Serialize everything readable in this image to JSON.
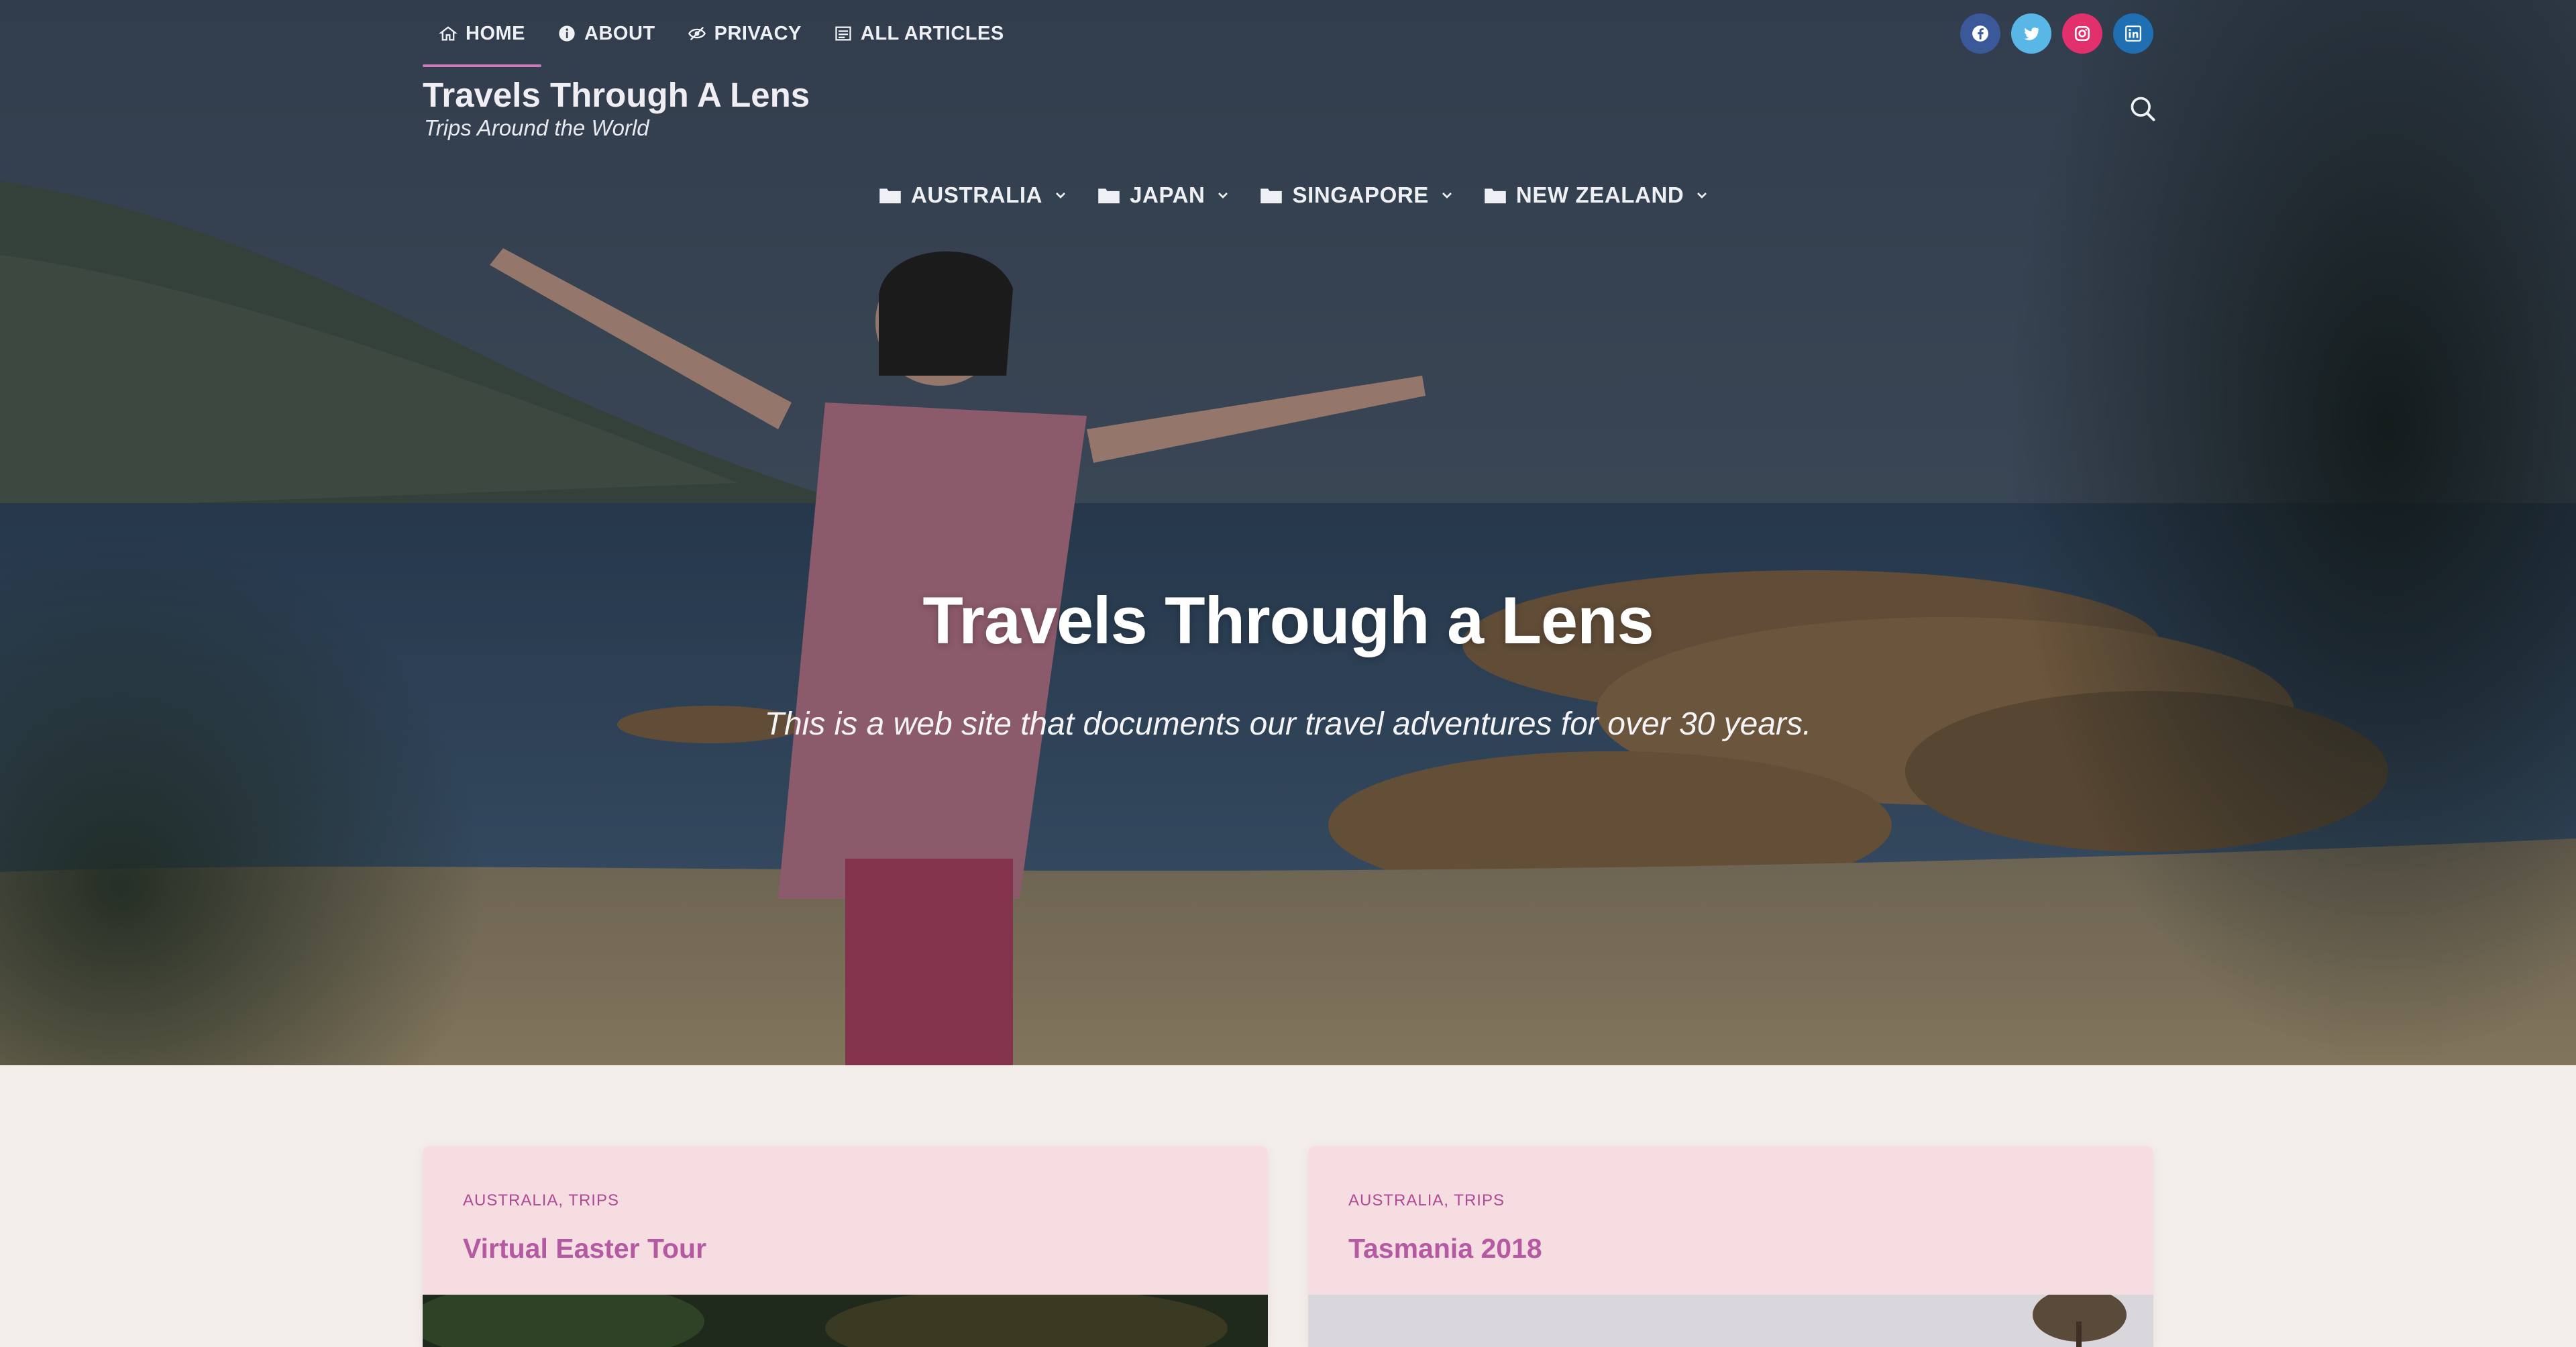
{
  "top_nav": [
    {
      "label": "HOME",
      "icon": "home-icon",
      "active": true
    },
    {
      "label": "ABOUT",
      "icon": "info-icon",
      "active": false
    },
    {
      "label": "PRIVACY",
      "icon": "eye-slash-icon",
      "active": false
    },
    {
      "label": "ALL ARTICLES",
      "icon": "list-icon",
      "active": false
    }
  ],
  "social": [
    {
      "name": "facebook",
      "icon": "facebook-icon",
      "color": "#3b5998"
    },
    {
      "name": "twitter",
      "icon": "twitter-icon",
      "color": "#58b7e6"
    },
    {
      "name": "instagram",
      "icon": "instagram-icon",
      "color": "#e1306c"
    },
    {
      "name": "linkedin",
      "icon": "linkedin-icon",
      "color": "#1f6fb2"
    }
  ],
  "site": {
    "title": "Travels Through A Lens",
    "tagline": "Trips Around the World"
  },
  "category_nav": [
    {
      "label": "AUSTRALIA"
    },
    {
      "label": "JAPAN"
    },
    {
      "label": "SINGAPORE"
    },
    {
      "label": "NEW ZEALAND"
    }
  ],
  "hero": {
    "heading": "Travels Through a Lens",
    "subheading": "This is a web site that documents our travel adventures for over 30 years."
  },
  "posts": [
    {
      "categories": [
        "AUSTRALIA",
        "TRIPS"
      ],
      "title": "Virtual Easter Tour"
    },
    {
      "categories": [
        "AUSTRALIA",
        "TRIPS"
      ],
      "title": "Tasmania 2018"
    }
  ],
  "colors": {
    "accent": "#b55aa2",
    "card_bg": "#f5dde2",
    "page_bg": "#f3eee9"
  }
}
